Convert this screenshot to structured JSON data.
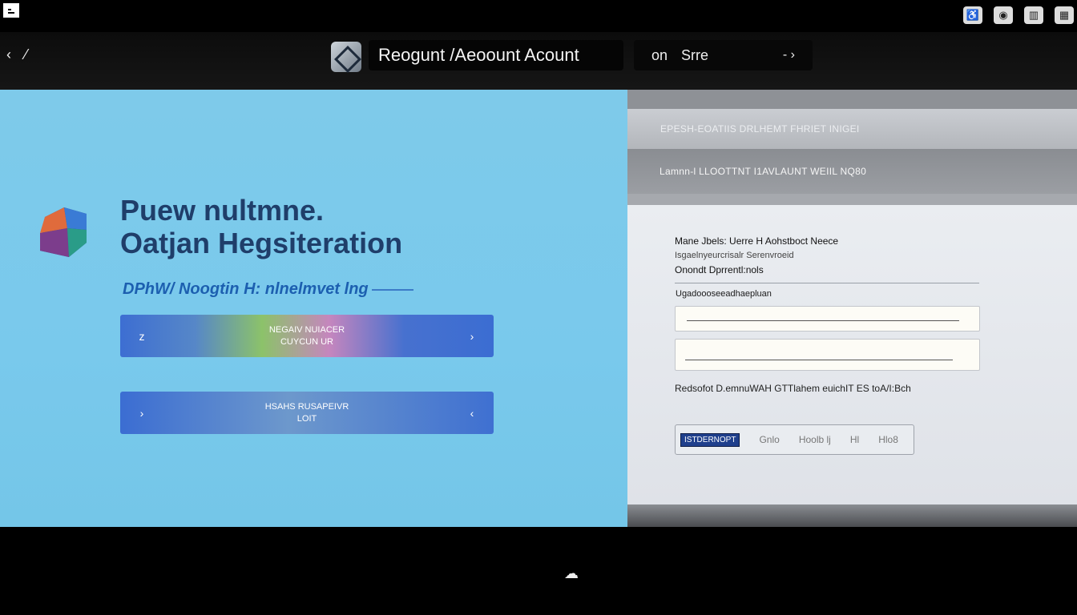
{
  "window": {
    "corner_icon": "menu-icon",
    "system_icons": [
      "accessibility-icon",
      "app-icon",
      "building-icon",
      "grid-icon"
    ]
  },
  "nav": {
    "back_icon": "back-arrow-icon",
    "back_glyph": "‹ ⁄",
    "title": "Reogunt /Aeoount Acount",
    "search_text": "on Srre",
    "search_suffix": "- ›"
  },
  "hero": {
    "headline_line1": "Puew nultmne.",
    "headline_line2": "Oatjan Hegsiteration",
    "subhead": "DPhW/ Noogtin H: nlnelmvet lng",
    "buttons": [
      {
        "label": "NEGAIV NUIACER\nCUYCUN UR",
        "left_icon": "z",
        "right_icon": "›"
      },
      {
        "label": "HSAHS RUSAPEIVR\nLOIT",
        "left_icon": "›",
        "right_icon": "‹"
      }
    ]
  },
  "form": {
    "banner1": "EPESH-EOATIIS DRLHEMT FHRIET INIGEI",
    "banner2": "Lamnn-l LLOOTTNT I1AVLAUNT WEIIL NQ80",
    "heading_line1": "Mane Jbels: Uerre H Aohstboct Neece",
    "heading_line2": "Isgaelnyeurcrisalr Serenvroeid",
    "heading_line3": "Onondt Dprrentl:nols",
    "field_label": "Ugadoooseeadhaepluan",
    "help_text": "Redsofot D.emnuWAH GTTlahem euichIT ES toA/I:Bch",
    "captcha_badge": "ISTDERNOPT",
    "captcha_items": [
      "Gnlo",
      "Hoolb lj",
      "Hl",
      "Hlo8"
    ]
  },
  "footer": {
    "icon": "cloud-sync-icon",
    "glyph": "☁"
  }
}
